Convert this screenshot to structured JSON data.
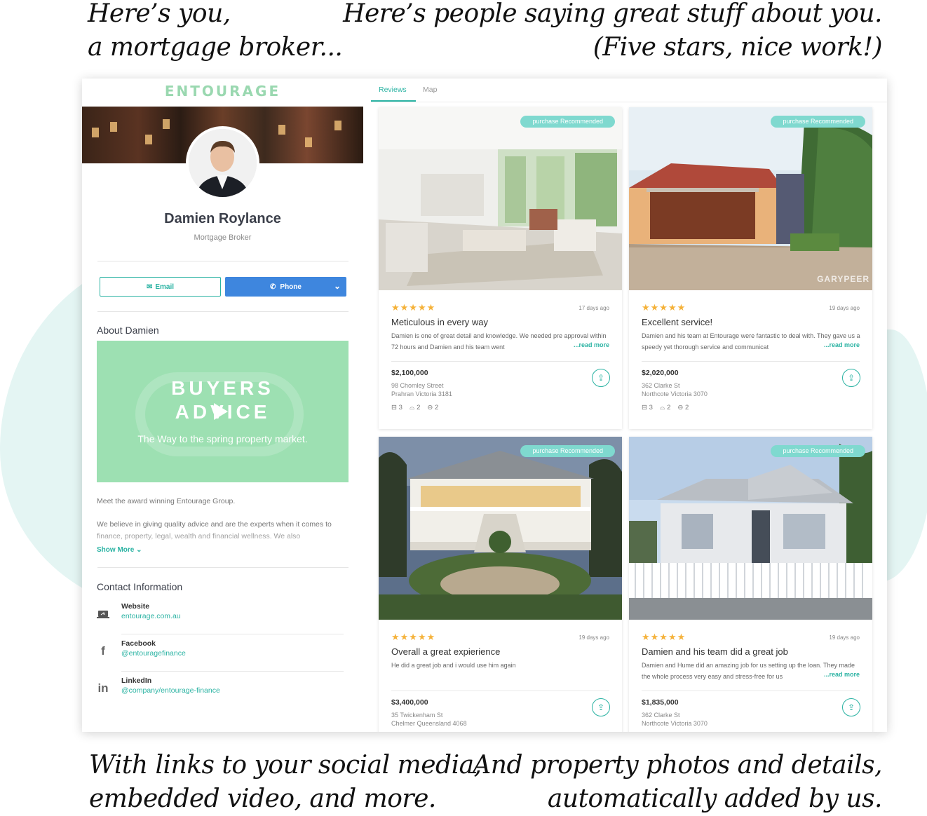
{
  "captions": {
    "top_left": [
      "Here’s you,",
      "a mortgage broker..."
    ],
    "top_right": [
      "Here’s people saying great stuff about you.",
      "(Five stars, nice work!)"
    ],
    "bottom_left": [
      "With links to your social media,",
      "embedded video, and more."
    ],
    "bottom_right": [
      "And property photos and details,",
      "automatically added by us."
    ]
  },
  "brand": {
    "logo": "ENTOURAGE",
    "accent": "#2bb3a3",
    "logo_color": "#9ad8b0",
    "phone_btn": "#3e86de"
  },
  "profile": {
    "name": "Damien Roylance",
    "role": "Mortgage Broker",
    "email_label": "Email",
    "phone_label": "Phone"
  },
  "about": {
    "title": "About Damien",
    "video_line1": "BUYERS",
    "video_line2": "ADVICE",
    "video_sub": "The Way to the spring property market.",
    "para1": "Meet the award winning Entourage Group.",
    "para2": "We believe in giving quality advice and are the experts when it comes to finance, property, legal, wealth and financial wellness. We also",
    "show_more": "Show More"
  },
  "contact": {
    "title": "Contact Information",
    "items": [
      {
        "label": "Website",
        "value": "entourage.com.au",
        "icon": "laptop-icon"
      },
      {
        "label": "Facebook",
        "value": "@entouragefinance",
        "icon": "facebook-icon"
      },
      {
        "label": "LinkedIn",
        "value": "@company/entourage-finance",
        "icon": "linkedin-icon"
      }
    ]
  },
  "tabs": [
    "Reviews",
    "Map"
  ],
  "reviews": [
    {
      "badge": "purchase Recommended",
      "stars": "★★★★★",
      "ago": "17 days ago",
      "title": "Meticulous in every way",
      "body": "Damien is one of great detail and knowledge. We needed pre approval within 72 hours and Damien and his team went",
      "read_more": "...read more",
      "price": "$2,100,000",
      "addr1": "98 Chomley Street",
      "addr2": "Prahran Victoria 3181",
      "beds": "3",
      "baths": "2",
      "cars": "2"
    },
    {
      "badge": "purchase Recommended",
      "stars": "★★★★★",
      "ago": "19 days ago",
      "title": "Excellent service!",
      "body": "Damien and his team at Entourage were fantastic to deal with. They gave us a speedy yet thorough service and communicat",
      "read_more": "...read more",
      "price": "$2,020,000",
      "addr1": "362 Clarke St",
      "addr2": "Northcote Victoria 3070",
      "beds": "3",
      "baths": "2",
      "cars": "2",
      "watermark": "GARYPEER"
    },
    {
      "badge": "purchase Recommended",
      "stars": "★★★★★",
      "ago": "19 days ago",
      "title": "Overall a great expierience",
      "body": "He did a great job and i would use him again",
      "price": "$3,400,000",
      "addr1": "35 Twickenham St",
      "addr2": "Chelmer Queensland 4068"
    },
    {
      "badge": "purchase Recommended",
      "stars": "★★★★★",
      "ago": "19 days ago",
      "title": "Damien and his team did a great job",
      "body": "Damien and Hume did an amazing job for us setting up the loan. They made the whole process very easy and stress-free for us",
      "read_more": "...read more",
      "price": "$1,835,000",
      "addr1": "362 Clarke St",
      "addr2": "Northcote Victoria 3070"
    }
  ]
}
